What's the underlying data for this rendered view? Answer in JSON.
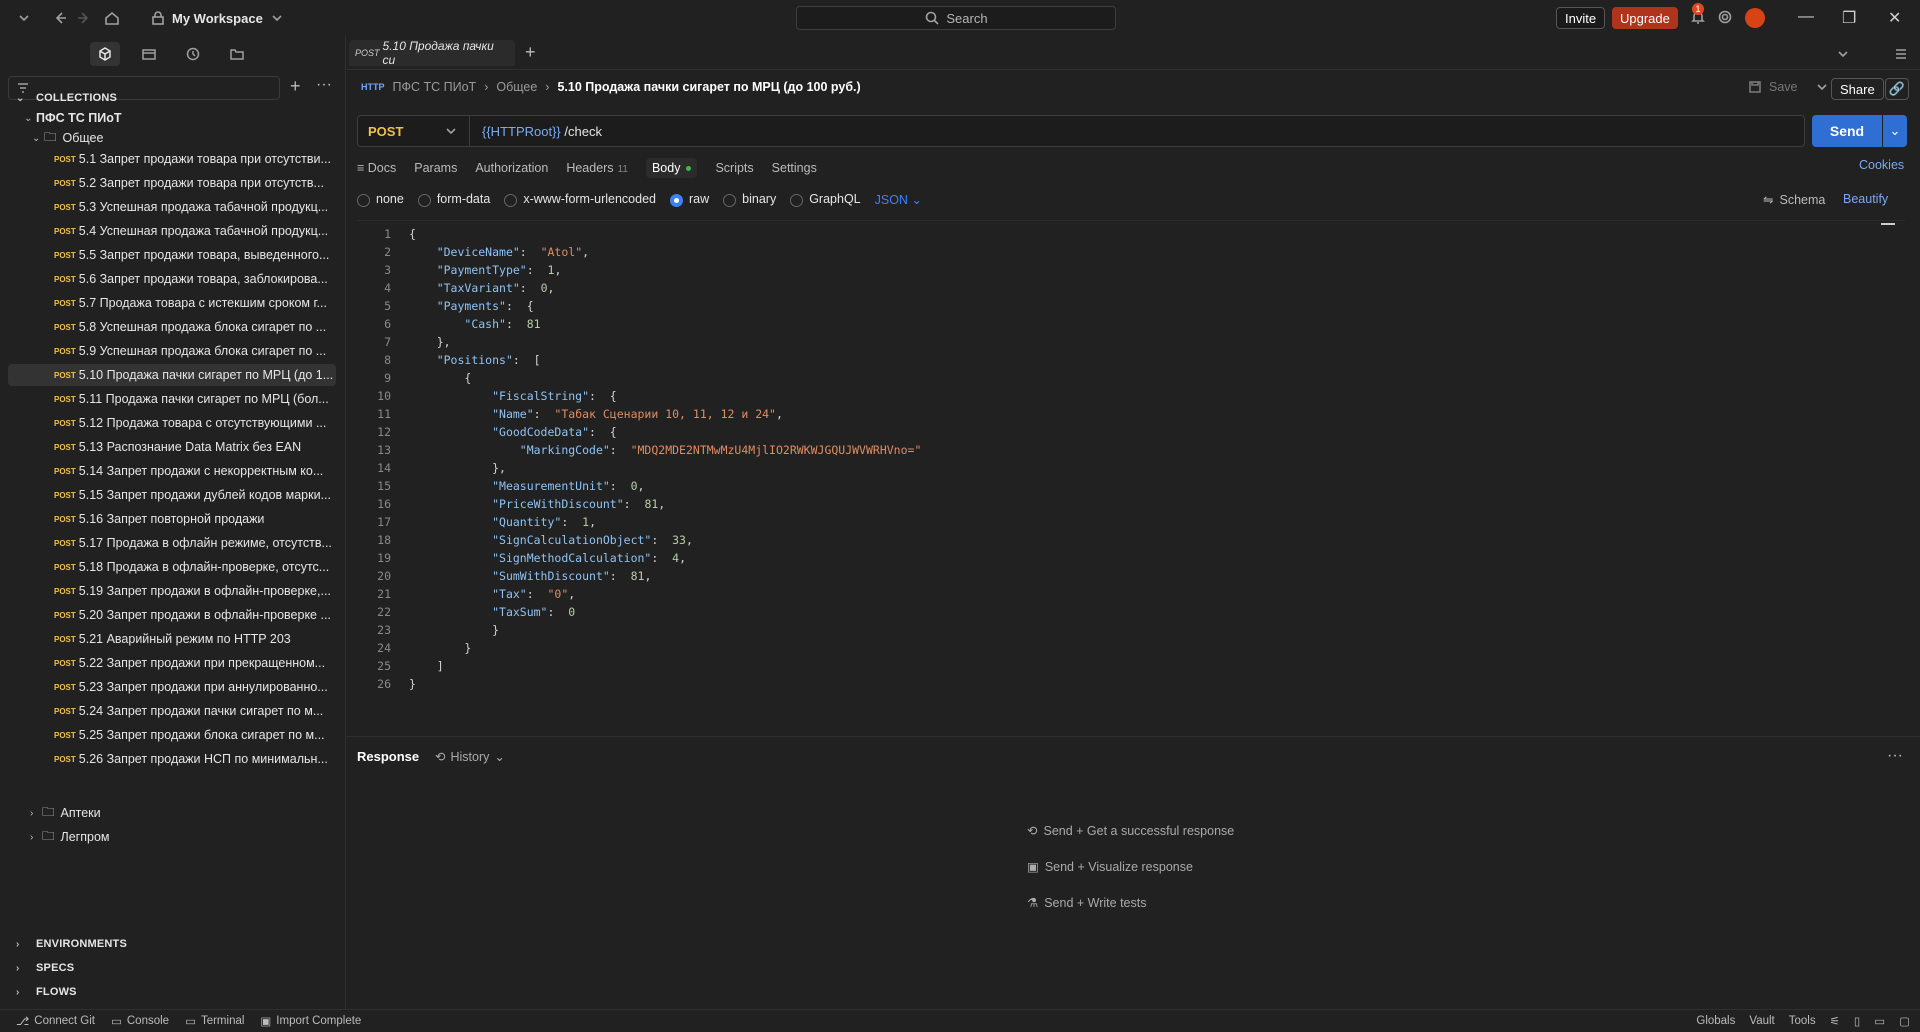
{
  "topbar": {
    "workspace": "My Workspace",
    "search_placeholder": "Search",
    "invite": "Invite",
    "upgrade": "Upgrade",
    "notification_count": "1"
  },
  "sidebar": {
    "collections_label": "COLLECTIONS",
    "collection_name": "ПФС ТС ПИоТ",
    "folder_open": "Общее",
    "requests": [
      "5.1 Запрет продажи товара при отсутстви...",
      "5.2 Запрет продажи товара при отсутств...",
      "5.3 Успешная продажа табачной продукц...",
      "5.4 Успешная продажа табачной продукц...",
      "5.5 Запрет продажи товара, выведенного...",
      "5.6 Запрет продажи товара, заблокирова...",
      "5.7 Продажа товара с истекшим сроком г...",
      "5.8 Успешная продажа блока сигарет по ...",
      "5.9 Успешная продажа блока сигарет по ...",
      "5.10 Продажа пачки сигарет по МРЦ (до 1...",
      "5.11 Продажа пачки сигарет по МРЦ (бол...",
      "5.12 Продажа товара с отсутствующими ...",
      "5.13 Распознание Data Matrix без EAN",
      "5.14 Запрет продажи с некорректным ко...",
      "5.15 Запрет продажи дублей кодов марки...",
      "5.16 Запрет повторной продажи",
      "5.17 Продажа в офлайн режиме, отсутств...",
      "5.18 Продажа в офлайн-проверке, отсутс...",
      "5.19 Запрет продажи в офлайн-проверке,...",
      "5.20 Запрет продажи в офлайн-проверке ...",
      "5.21 Аварийный режим по HTTP 203",
      "5.22 Запрет продажи при прекращенном...",
      "5.23 Запрет продажи при аннулированно...",
      "5.24 Запрет продажи пачки сигарет по м...",
      "5.25 Запрет продажи блока сигарет по м...",
      "5.26 Запрет продажи НСП по минимальн..."
    ],
    "request_method": "POST",
    "folders_closed": [
      "Аптеки",
      "Легпром"
    ],
    "environments": "ENVIRONMENTS",
    "specs": "SPECS",
    "flows": "FLOWS"
  },
  "tab": {
    "method": "POST",
    "title": "5.10 Продажа пачки си"
  },
  "breadcrumb": {
    "collection": "ПФС ТС ПИоТ",
    "folder": "Общее",
    "current": "5.10 Продажа пачки сигарет по МРЦ (до 100 руб.)",
    "http": "HTTP"
  },
  "actions": {
    "save": "Save",
    "share": "Share",
    "send": "Send"
  },
  "request": {
    "method": "POST",
    "url_var": "{{HTTPRoot}}",
    "url_path": " /check"
  },
  "subtabs": {
    "docs": "Docs",
    "params": "Params",
    "authorization": "Authorization",
    "headers": "Headers",
    "headers_count": "11",
    "body": "Body",
    "scripts": "Scripts",
    "settings": "Settings",
    "cookies": "Cookies"
  },
  "body_options": {
    "none": "none",
    "form_data": "form-data",
    "urlencoded": "x-www-form-urlencoded",
    "raw": "raw",
    "binary": "binary",
    "graphql": "GraphQL",
    "format": "JSON",
    "schema": "Schema",
    "beautify": "Beautify"
  },
  "response": {
    "title": "Response",
    "history": "History",
    "hints": [
      "Send + Get a successful response",
      "Send + Visualize response",
      "Send + Write tests"
    ]
  },
  "statusbar": {
    "connect_git": "Connect Git",
    "console": "Console",
    "terminal": "Terminal",
    "import": "Import Complete",
    "globals": "Globals",
    "vault": "Vault",
    "tools": "Tools"
  },
  "colors": {
    "accent": "#2f6fd3",
    "post": "#f2c04e",
    "upgrade": "#b0331b"
  }
}
